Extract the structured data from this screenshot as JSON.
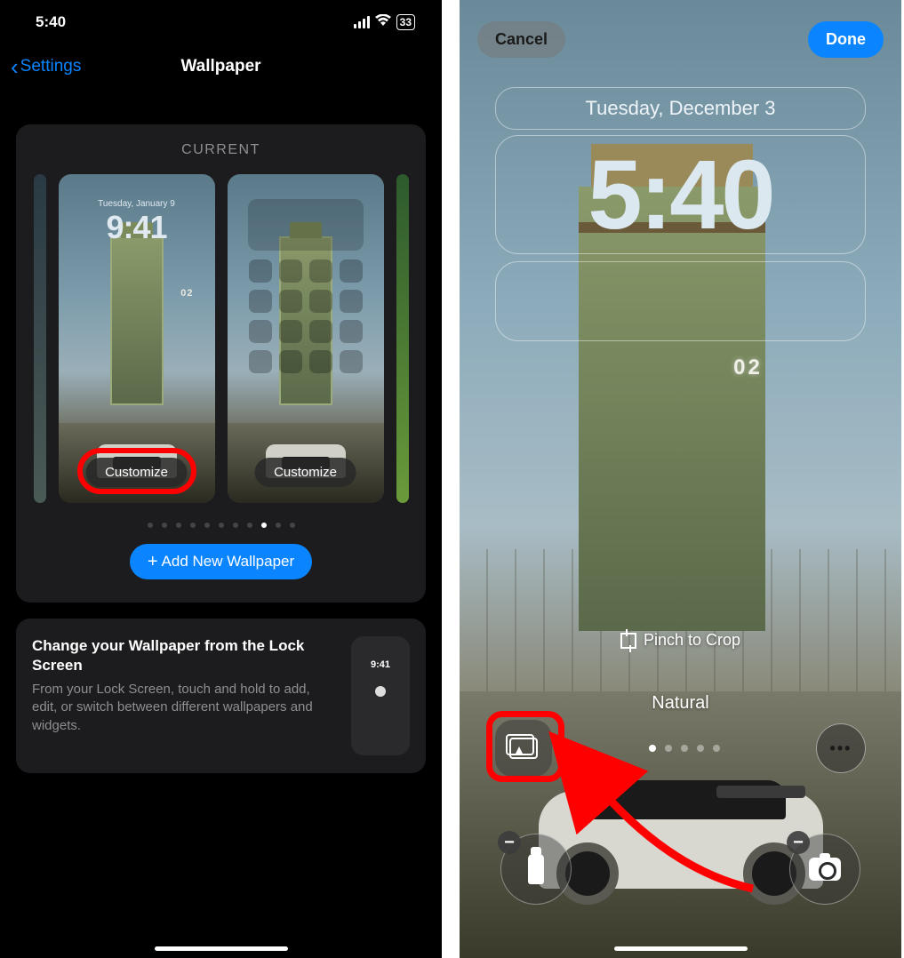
{
  "left": {
    "status": {
      "time": "5:40",
      "battery": "33"
    },
    "nav": {
      "back": "Settings",
      "title": "Wallpaper"
    },
    "card": {
      "heading": "CURRENT",
      "preview": {
        "date": "Tuesday, January 9",
        "time": "9:41",
        "num02": "02"
      },
      "customize_lock": "Customize",
      "customize_home": "Customize",
      "add_button": "Add New Wallpaper"
    },
    "tip": {
      "title": "Change your Wallpaper from the Lock Screen",
      "body": "From your Lock Screen, touch and hold to add, edit, or switch between different wallpapers and widgets.",
      "mini_time": "9:41"
    }
  },
  "right": {
    "top": {
      "cancel": "Cancel",
      "done": "Done"
    },
    "lockscreen": {
      "date": "Tuesday, December 3",
      "time": "5:40",
      "num02": "02"
    },
    "pinch_label": "Pinch to Crop",
    "filter_label": "Natural",
    "remove_badge": "−"
  }
}
